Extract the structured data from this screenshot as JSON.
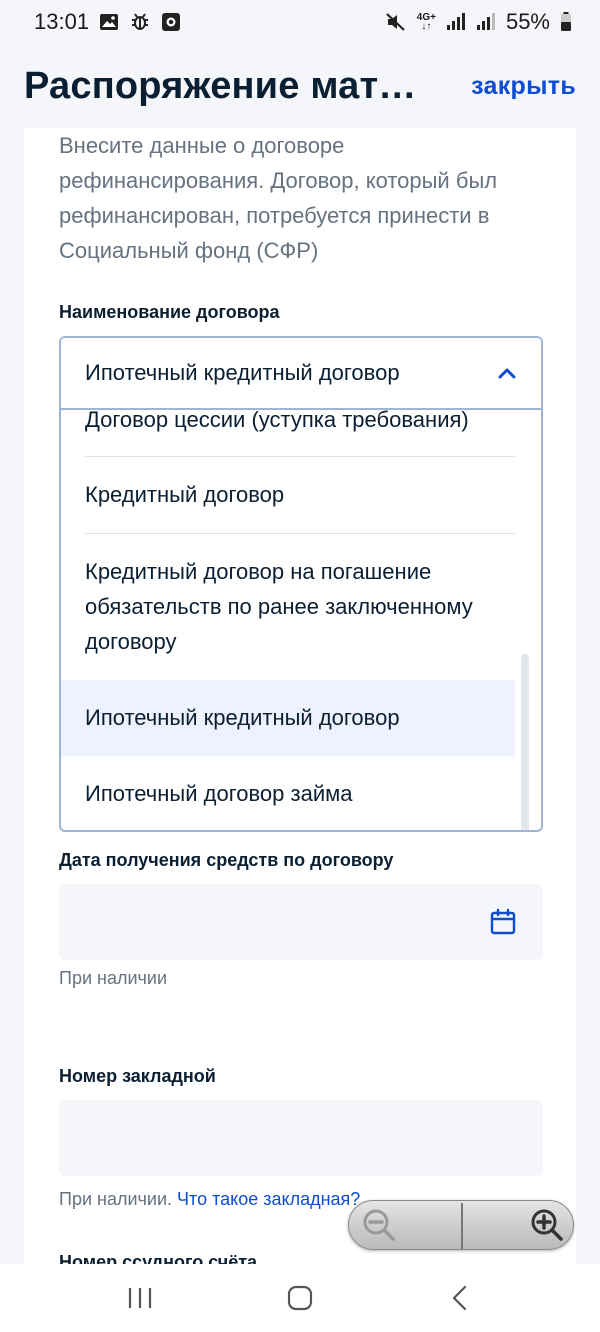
{
  "status_bar": {
    "time": "13:01",
    "network_top": "4G+",
    "network_bottom": "↓↑",
    "battery": "55%"
  },
  "header": {
    "title": "Распоряжение мате…",
    "close_label": "закрыть"
  },
  "form": {
    "intro": "Внесите данные о договоре рефинансирования. Договор, который был рефинансирован, потребуется принести в Социальный фонд (СФР)",
    "contract_name": {
      "label": "Наименование договора",
      "selected": "Ипотечный кредитный договор",
      "options": [
        "Договор цессии (уступка требования)",
        "Кредитный договор",
        "Кредитный договор на погашение обязательств по ранее заключенному договору",
        "Ипотечный кредитный договор",
        "Ипотечный договор займа"
      ]
    },
    "date_field": {
      "label": "Дата получения средств по договору",
      "hint": "При наличии"
    },
    "mortgage_field": {
      "label": "Номер закладной",
      "hint": "При наличии.",
      "hint_link": "Что такое закладная?"
    },
    "loan_account_label": "Номер ссудного счёта"
  },
  "colors": {
    "accent": "#0d4cd3",
    "text": "#0b1f33",
    "muted": "#66727f",
    "field_bg": "#f4f6f9",
    "selected_bg": "#edf2fe"
  }
}
